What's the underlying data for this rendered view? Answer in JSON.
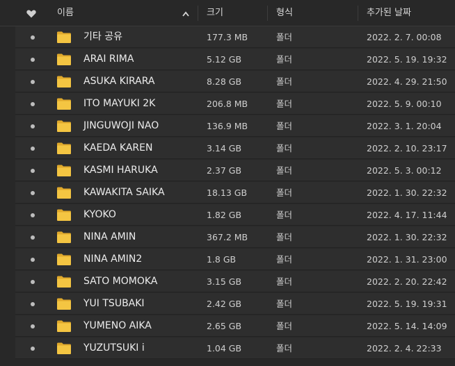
{
  "header": {
    "favorite_icon": "heart-icon",
    "name_label": "이름",
    "sort_indicator": "chevron-up-icon",
    "size_label": "크기",
    "type_label": "형식",
    "date_label": "추가된 날짜"
  },
  "colors": {
    "background": "#282828",
    "row_background": "#2e2e2e",
    "folder_yellow": "#f4c542",
    "text": "#ececec"
  },
  "rows": [
    {
      "name": "기타 공유",
      "size": "177.3 MB",
      "type": "폴더",
      "date": "2022. 2. 7. 00:08",
      "icon": "folder-icon"
    },
    {
      "name": "ARAI RIMA",
      "size": "5.12 GB",
      "type": "폴더",
      "date": "2022. 5. 19. 19:32",
      "icon": "folder-icon"
    },
    {
      "name": "ASUKA KIRARA",
      "size": "8.28 GB",
      "type": "폴더",
      "date": "2022. 4. 29. 21:50",
      "icon": "folder-icon"
    },
    {
      "name": "ITO MAYUKI 2K",
      "size": "206.8 MB",
      "type": "폴더",
      "date": "2022. 5. 9. 00:10",
      "icon": "folder-icon"
    },
    {
      "name": "JINGUWOJI NAO",
      "size": "136.9 MB",
      "type": "폴더",
      "date": "2022. 3. 1. 20:04",
      "icon": "folder-icon"
    },
    {
      "name": "KAEDA KAREN",
      "size": "3.14 GB",
      "type": "폴더",
      "date": "2022. 2. 10. 23:17",
      "icon": "folder-icon"
    },
    {
      "name": "KASMI HARUKA",
      "size": "2.37 GB",
      "type": "폴더",
      "date": "2022. 5. 3. 00:12",
      "icon": "folder-icon"
    },
    {
      "name": "KAWAKITA SAIKA",
      "size": "18.13 GB",
      "type": "폴더",
      "date": "2022. 1. 30. 22:32",
      "icon": "folder-icon"
    },
    {
      "name": "KYOKO",
      "size": "1.82 GB",
      "type": "폴더",
      "date": "2022. 4. 17. 11:44",
      "icon": "folder-icon"
    },
    {
      "name": "NINA AMIN",
      "size": "367.2 MB",
      "type": "폴더",
      "date": "2022. 1. 30. 22:32",
      "icon": "folder-icon"
    },
    {
      "name": "NINA AMIN2",
      "size": "1.8 GB",
      "type": "폴더",
      "date": "2022. 1. 31. 23:00",
      "icon": "folder-icon"
    },
    {
      "name": "SATO MOMOKA",
      "size": "3.15 GB",
      "type": "폴더",
      "date": "2022. 2. 20. 22:42",
      "icon": "folder-icon"
    },
    {
      "name": "YUI TSUBAKI",
      "size": "2.42 GB",
      "type": "폴더",
      "date": "2022. 5. 19. 19:31",
      "icon": "folder-icon"
    },
    {
      "name": "YUMENO AIKA",
      "size": "2.65 GB",
      "type": "폴더",
      "date": "2022. 5. 14. 14:09",
      "icon": "folder-icon"
    },
    {
      "name": "YUZUTSUKI i",
      "size": "1.04 GB",
      "type": "폴더",
      "date": "2022. 2. 4. 22:33",
      "icon": "folder-icon"
    }
  ]
}
